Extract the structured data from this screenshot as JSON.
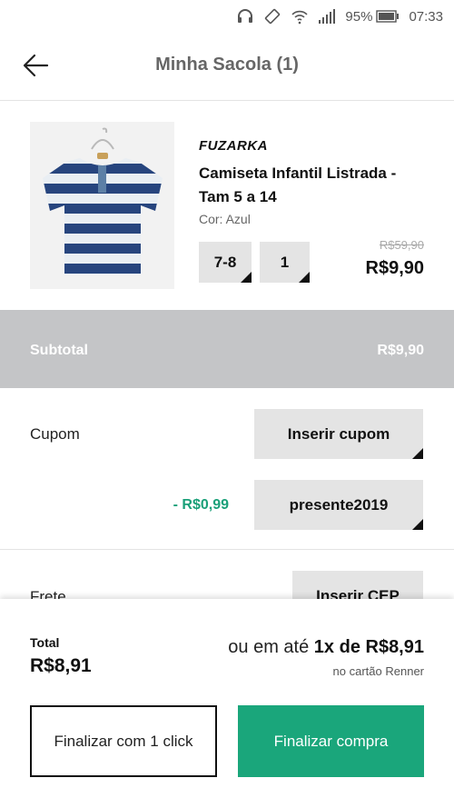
{
  "statusbar": {
    "battery": "95%",
    "time": "07:33",
    "icons": [
      "headphones-icon",
      "vibrate-icon",
      "wifi-icon",
      "signal-icon",
      "battery-icon"
    ]
  },
  "header": {
    "title": "Minha Sacola (1)",
    "back_icon": "arrow-left-icon"
  },
  "product": {
    "brand": "FUZARKA",
    "name": "Camiseta Infantil Listrada - Tam 5 a 14",
    "color_label": "Cor: Azul",
    "size": "7-8",
    "quantity": "1",
    "old_price": "R$59,90",
    "price": "R$9,90",
    "image_icon": "striped-tshirt-image"
  },
  "subtotal": {
    "label": "Subtotal",
    "value": "R$9,90"
  },
  "coupon": {
    "label": "Cupom",
    "insert_label": "Inserir cupom",
    "discount": "- R$0,99",
    "code": "presente2019"
  },
  "shipping": {
    "label": "Frete",
    "insert_label": "Inserir CEP"
  },
  "summary": {
    "total_label": "Total",
    "total_value": "R$8,91",
    "installment_prefix": "ou em até",
    "installment_value": "1x de R$8,91",
    "card_note": "no cartão Renner",
    "one_click_label": "Finalizar com 1 click",
    "checkout_label": "Finalizar compra"
  },
  "colors": {
    "accent_green": "#1aa67b",
    "subtotal_bg": "#c4c5c7",
    "selector_bg": "#e4e4e4"
  }
}
